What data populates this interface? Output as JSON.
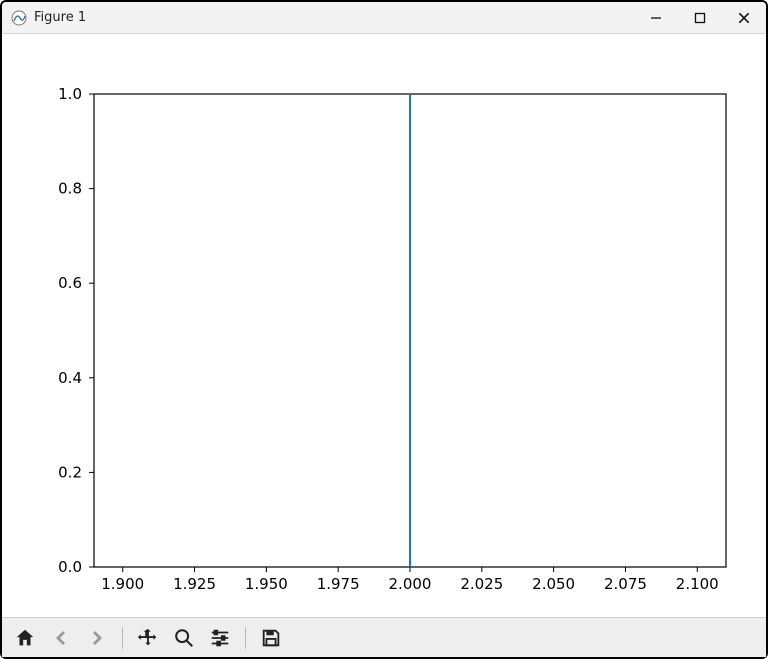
{
  "window": {
    "title": "Figure 1"
  },
  "toolbar": {
    "home": "Home",
    "back": "Back",
    "forward": "Forward",
    "pan": "Pan",
    "zoom": "Zoom",
    "configure": "Configure subplots",
    "save": "Save"
  },
  "chart_data": {
    "type": "line",
    "x": [
      2.0,
      2.0
    ],
    "y": [
      0.0,
      1.0
    ],
    "title": "",
    "xlabel": "",
    "ylabel": "",
    "xlim": [
      1.89,
      2.11
    ],
    "ylim": [
      0.0,
      1.0
    ],
    "xticks": [
      1.9,
      1.925,
      1.95,
      1.975,
      2.0,
      2.025,
      2.05,
      2.075,
      2.1
    ],
    "xticklabels": [
      "1.900",
      "1.925",
      "1.950",
      "1.975",
      "2.000",
      "2.025",
      "2.050",
      "2.075",
      "2.100"
    ],
    "yticks": [
      0.0,
      0.2,
      0.4,
      0.6,
      0.8,
      1.0
    ],
    "yticklabels": [
      "0.0",
      "0.2",
      "0.4",
      "0.6",
      "0.8",
      "1.0"
    ],
    "series_color": "#1f77b4"
  }
}
